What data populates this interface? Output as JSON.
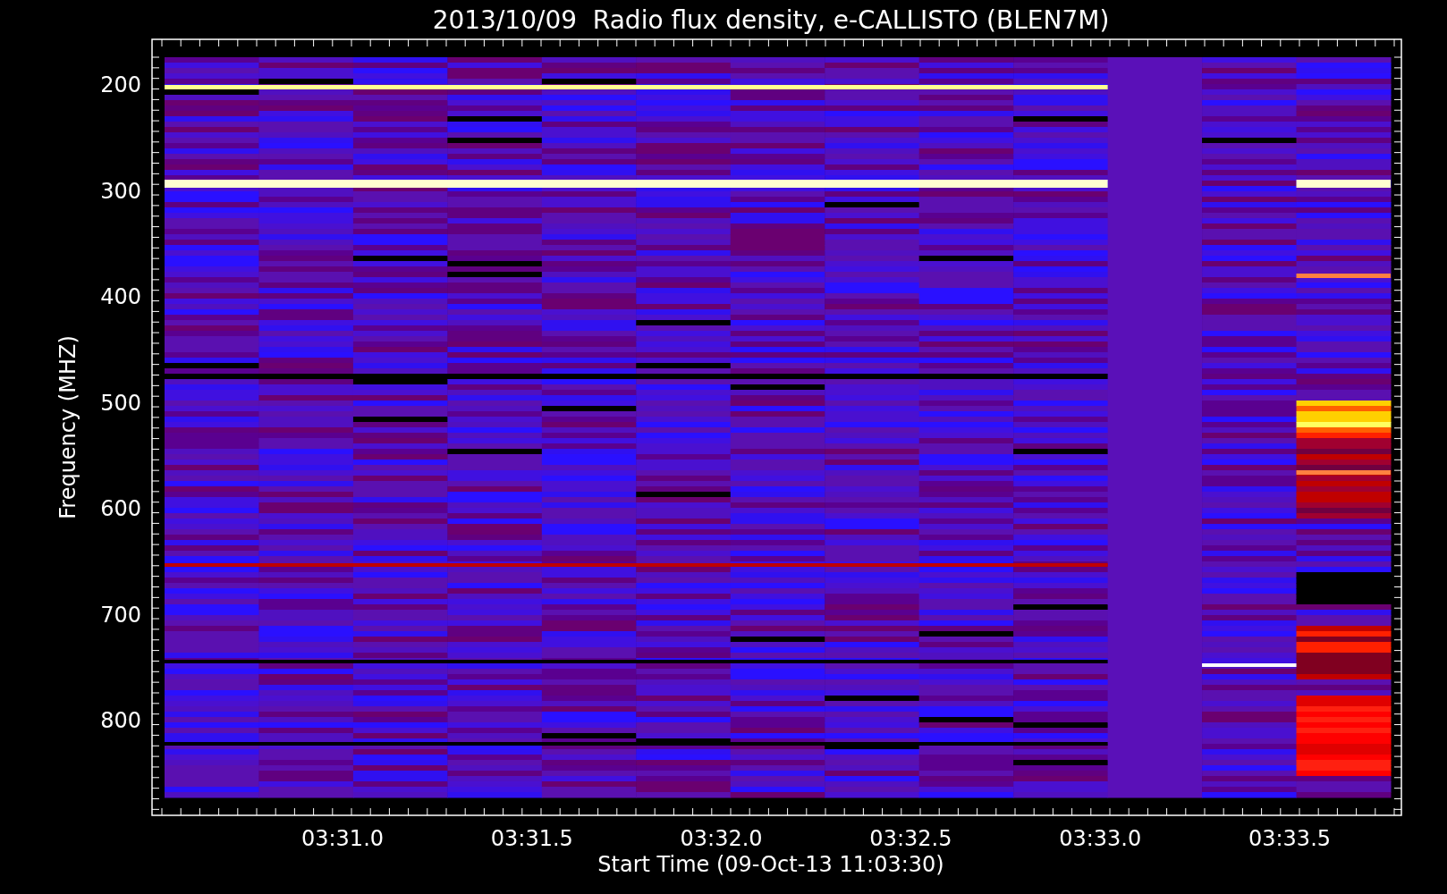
{
  "title": "2013/10/09  Radio flux density, e-CALLISTO (BLEN7M)",
  "y_axis": {
    "label": "Frequency (MHZ)",
    "ticks": [
      "200",
      "300",
      "400",
      "500",
      "600",
      "700",
      "800"
    ]
  },
  "x_axis": {
    "label": "Start Time (09-Oct-13 11:03:30)",
    "ticks": [
      "03:31.0",
      "03:31.5",
      "03:32.0",
      "03:32.5",
      "03:33.0",
      "03:33.5"
    ]
  }
}
